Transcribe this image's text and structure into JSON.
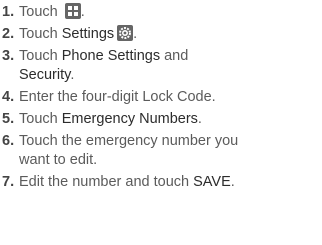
{
  "steps": [
    {
      "number": "1.",
      "pre": "Touch ",
      "icon": "apps-grid-icon",
      "post": "."
    },
    {
      "number": "2.",
      "pre": "Touch ",
      "keyword": "Settings",
      "icon": "settings-gear-icon",
      "post": "."
    },
    {
      "number": "3.",
      "pre": "Touch ",
      "keyword": "Phone Settings",
      "mid": " and",
      "keyword2": "Security",
      "post": "."
    },
    {
      "number": "4.",
      "text": "Enter the four-digit Lock Code."
    },
    {
      "number": "5.",
      "pre": "Touch ",
      "keyword": "Emergency Numbers",
      "post": "."
    },
    {
      "number": "6.",
      "text": "Touch the emergency number you",
      "text2": "want to edit."
    },
    {
      "number": "7.",
      "pre": "Edit the number and touch ",
      "keyword": "SAVE",
      "post": "."
    }
  ],
  "colors": {
    "text": "#5b5b5b",
    "keyword": "#2c2c2c",
    "icon_bg": "#666666"
  }
}
